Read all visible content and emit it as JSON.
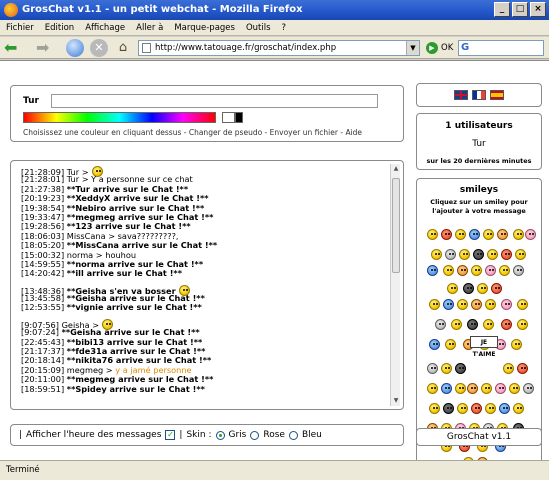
{
  "window": {
    "title": "GrosChat v1.1 - un petit webchat - Mozilla Firefox"
  },
  "menu": {
    "items": [
      "Fichier",
      "Edition",
      "Affichage",
      "Aller à",
      "Marque-pages",
      "Outils",
      "?"
    ]
  },
  "navbar": {
    "url": "http://www.tatouage.fr/groschat/index.php",
    "go_label": "OK",
    "search_engine_letter": "G"
  },
  "input_panel": {
    "nick_label": "Tur",
    "instructions": "Choisissez une couleur en cliquant dessus - Changer de pseudo - Envoyer un fichier - Aide"
  },
  "flags": [
    "uk-flag",
    "fr-flag",
    "es-flag"
  ],
  "users_panel": {
    "count_label": "1 utilisateurs",
    "users": [
      "Tur"
    ],
    "note": "sur les 20 dernières minutes"
  },
  "smileys_panel": {
    "title": "smileys",
    "help": "Cliquez sur un smiley pour l'ajouter à votre message",
    "jetaime_label": "JE T'AIME"
  },
  "chat": {
    "lines": [
      {
        "ts": "[21:28:09]",
        "text": "Tur >",
        "style": "normal",
        "smiley": true
      },
      {
        "ts": "[21:28:01]",
        "text": "Tur > Y a personne sur ce chat",
        "style": "normal"
      },
      {
        "ts": "[21:27:38]",
        "text": "**Tur arrive sur le Chat !**",
        "style": "bold"
      },
      {
        "ts": "[20:19:23]",
        "text": "**XeddyX arrive sur le Chat !**",
        "style": "bold"
      },
      {
        "ts": "[19:38:54]",
        "text": "**Nebiro arrive sur le Chat !**",
        "style": "bold"
      },
      {
        "ts": "[19:33:47]",
        "text": "**megmeg arrive sur le Chat !**",
        "style": "bold"
      },
      {
        "ts": "[19:28:56]",
        "text": "**123 arrive sur le Chat !**",
        "style": "bold"
      },
      {
        "ts": "[18:06:03]",
        "text": "MissCana > sava?????????,",
        "style": "normal"
      },
      {
        "ts": "[18:05:20]",
        "text": "**MissCana arrive sur le Chat !**",
        "style": "bold"
      },
      {
        "ts": "[15:00:32]",
        "text": "norma > houhou",
        "style": "normal"
      },
      {
        "ts": "[14:59:55]",
        "text": "**norma arrive sur le Chat !**",
        "style": "bold"
      },
      {
        "ts": "[14:20:42]",
        "text": "**ill arrive sur le Chat !**",
        "style": "bold"
      },
      {
        "ts": "[13:48:36]",
        "text": "**Geisha s'en va bosser",
        "style": "bold",
        "smiley": true,
        "gap": true
      },
      {
        "ts": "[13:45:58]",
        "text": "**Geisha arrive sur le Chat !**",
        "style": "bold"
      },
      {
        "ts": "[12:53:55]",
        "text": "**vignie arrive sur le Chat !**",
        "style": "bold"
      },
      {
        "ts": "[9:07:56]",
        "text": "Geisha >",
        "style": "normal",
        "smiley": true,
        "gap": true
      },
      {
        "ts": "[9:07:24]",
        "text": "**Geisha arrive sur le Chat !**",
        "style": "bold"
      },
      {
        "ts": "[22:45:43]",
        "text": "**bibi13 arrive sur le Chat !**",
        "style": "bold"
      },
      {
        "ts": "[21:17:37]",
        "text": "**fde31a arrive sur le Chat !**",
        "style": "bold"
      },
      {
        "ts": "[20:18:14]",
        "text": "**nikita76 arrive sur le Chat !**",
        "style": "bold"
      },
      {
        "ts": "[20:15:09]",
        "text": "megmeg > ",
        "style": "normal",
        "extra": "y a jamé personne",
        "extra_style": "orange"
      },
      {
        "ts": "[20:11:00]",
        "text": "**megmeg arrive sur le Chat !**",
        "style": "bold"
      },
      {
        "ts": "[18:59:51]",
        "text": "**Spidey arrive sur le Chat !**",
        "style": "bold"
      }
    ]
  },
  "options": {
    "show_time_label": "Afficher l'heure des messages",
    "show_time_checked": true,
    "skin_label": "Skin :",
    "skins": [
      {
        "label": "Gris",
        "checked": true
      },
      {
        "label": "Rose",
        "checked": false
      },
      {
        "label": "Bleu",
        "checked": false
      }
    ]
  },
  "footer": {
    "label": "GrosChat v1.1"
  },
  "status": {
    "text": "Terminé"
  }
}
